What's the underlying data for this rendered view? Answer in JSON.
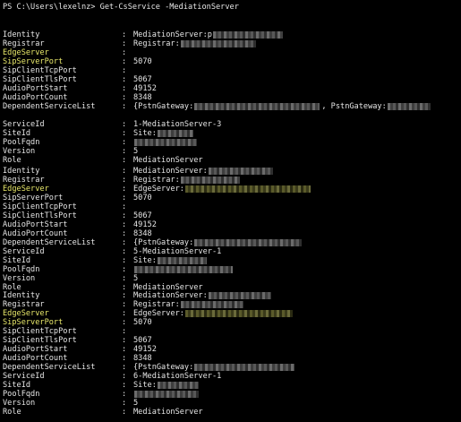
{
  "prompt": "PS C:\\Users\\lexelnz> Get-CsService -MediationServer",
  "colon": ":",
  "blocks": [
    {
      "rows": [
        {
          "key": "Identity",
          "val": "MediationServer:p",
          "redact": true
        },
        {
          "key": "Registrar",
          "val": "Registrar:",
          "redact": true
        },
        {
          "key": "EdgeServer",
          "val": "",
          "hl": true
        },
        {
          "key": "SipServerPort",
          "val": "5070",
          "hl": true
        },
        {
          "key": "SipClientTcpPort",
          "val": ""
        },
        {
          "key": "SipClientTlsPort",
          "val": "5067"
        },
        {
          "key": "AudioPortStart",
          "val": "49152"
        },
        {
          "key": "AudioPortCount",
          "val": "8348"
        },
        {
          "key": "DependentServiceList",
          "val": "{PstnGateway:",
          "redact": true,
          "extra": ", PstnGateway:"
        },
        {
          "key": "",
          "val": ""
        },
        {
          "key": "ServiceId",
          "val": "1-MediationServer-3"
        },
        {
          "key": "SiteId",
          "val": "Site:",
          "redact": true
        },
        {
          "key": "PoolFqdn",
          "val": "",
          "redact": true
        },
        {
          "key": "Version",
          "val": "5"
        },
        {
          "key": "Role",
          "val": "MediationServer"
        }
      ]
    },
    {
      "rows": [
        {
          "key": "Identity",
          "val": "MediationServer:",
          "redact": true
        },
        {
          "key": "Registrar",
          "val": "Registrar:",
          "redact": true
        },
        {
          "key": "EdgeServer",
          "val": "EdgeServer:",
          "redact": true,
          "hl": true
        },
        {
          "key": "SipServerPort",
          "val": "5070"
        },
        {
          "key": "SipClientTcpPort",
          "val": ""
        },
        {
          "key": "SipClientTlsPort",
          "val": "5067"
        },
        {
          "key": "AudioPortStart",
          "val": "49152"
        },
        {
          "key": "AudioPortCount",
          "val": "8348"
        },
        {
          "key": "DependentServiceList",
          "val": "{PstnGateway:",
          "redact": true
        },
        {
          "key": "ServiceId",
          "val": "5-MediationServer-1"
        },
        {
          "key": "SiteId",
          "val": "Site:",
          "redact": true
        },
        {
          "key": "PoolFqdn",
          "val": "",
          "redact": true
        },
        {
          "key": "Version",
          "val": "5"
        },
        {
          "key": "Role",
          "val": "MediationServer"
        }
      ]
    },
    {
      "rows": [
        {
          "key": "Identity",
          "val": "MediationServer:",
          "redact": true
        },
        {
          "key": "Registrar",
          "val": "Registrar:",
          "redact": true
        },
        {
          "key": "EdgeServer",
          "val": "EdgeServer:",
          "redact": true,
          "hl": true
        },
        {
          "key": "SipServerPort",
          "val": "5070",
          "hl": true
        },
        {
          "key": "SipClientTcpPort",
          "val": ""
        },
        {
          "key": "SipClientTlsPort",
          "val": "5067"
        },
        {
          "key": "AudioPortStart",
          "val": "49152"
        },
        {
          "key": "AudioPortCount",
          "val": "8348"
        },
        {
          "key": "DependentServiceList",
          "val": "{PstnGateway:",
          "redact": true
        },
        {
          "key": "ServiceId",
          "val": "6-MediationServer-1"
        },
        {
          "key": "SiteId",
          "val": "Site:",
          "redact": true
        },
        {
          "key": "PoolFqdn",
          "val": "",
          "redact": true
        },
        {
          "key": "Version",
          "val": "5"
        },
        {
          "key": "Role",
          "val": "MediationServer"
        }
      ]
    }
  ]
}
